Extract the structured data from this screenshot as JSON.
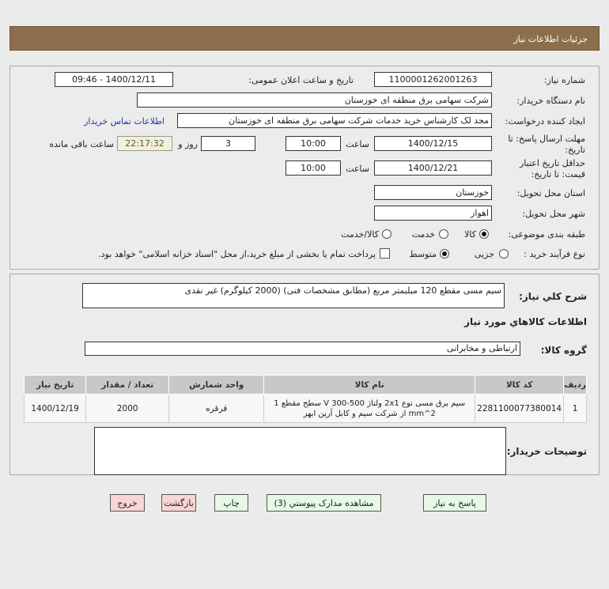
{
  "header": {
    "title": "جزئیات اطلاعات نیاز"
  },
  "form": {
    "need_number_label": "شماره نیاز:",
    "need_number": "1100001262001263",
    "announce_label": "تاریخ و ساعت اعلان عمومی:",
    "announce_value": "1400/12/11 - 09:46",
    "buyer_org_label": "نام دستگاه خریدار:",
    "buyer_org": "شرکت سهامی برق منطقه ای خوزستان",
    "creator_label": "ایجاد کننده درخواست:",
    "creator": "مجد لک کارشناس خرید خدمات شرکت سهامی برق منطقه ای خوزستان",
    "contact_link": "اطلاعات تماس خریدار",
    "deadline_label_1": "مهلت ارسال پاسخ: تا",
    "deadline_label_2": "تاریخ:",
    "deadline_date": "1400/12/15",
    "time_label": "ساعت",
    "deadline_time": "10:00",
    "days": "3",
    "days_label": "روز و",
    "remaining": "22:17:32",
    "remaining_label": "ساعت باقی مانده",
    "validity_label_1": "حداقل تاریخ اعتبار",
    "validity_label_2": "قیمت: تا تاریخ:",
    "validity_date": "1400/12/21",
    "validity_time": "10:00",
    "province_label": "استان محل تحویل:",
    "province": "خوزستان",
    "city_label": "شهر محل تحویل:",
    "city": "اهواز",
    "category_label": "طبقه بندی موضوعی:",
    "category_options": [
      "کالا",
      "خدمت",
      "کالا/خدمت"
    ],
    "category_selected": "کالا",
    "process_label": "نوع فرآیند خرید :",
    "process_options": [
      "جزیی",
      "متوسط"
    ],
    "process_selected": "متوسط",
    "payment_note": "پرداخت تمام یا بخشی از مبلغ خرید،از محل \"اسناد خزانه اسلامی\" خواهد بود.",
    "payment_checked": false
  },
  "details": {
    "summary_label": "شرح کلي نیاز:",
    "summary": "سیم مسی مقطع 120 میلیمتر مربع  (مطابق مشخصات فنی) (2000 کیلوگرم)     غیر نقدی",
    "goods_info_title": "اطلاعات کالاهاي مورد نیاز",
    "group_label": "گروه کالا:",
    "group": "ارتباطی و مخابراتی",
    "table": {
      "headers": [
        "ردیف",
        "کد کالا",
        "نام کالا",
        "واحد شمارش",
        "تعداد / مقدار",
        "تاریخ نیاز"
      ],
      "rows": [
        [
          "1",
          "2281100077380014",
          "سیم برق مسی نوع 2x1 ولتاژ 500-300 V سطح مقطع 1 mm^2 از شرکت سیم و کابل آرین ابهر",
          "قرقره",
          "2000",
          "1400/12/19"
        ]
      ]
    },
    "buyer_notes_label": "توضیحات خریدار:",
    "buyer_notes": ""
  },
  "buttons": {
    "reply": "پاسخ به نیاز",
    "attachments": "مشاهده مدارک پیوستي (3)",
    "print": "چاپ",
    "back": "بازگشت",
    "exit": "خروج"
  },
  "colors": {
    "header": "#8c6e4c",
    "green_button": "#e6f8e6",
    "pink_button": "#f8d6d6",
    "remaining_bg": "#f3f0d6",
    "link": "#2233aa"
  }
}
